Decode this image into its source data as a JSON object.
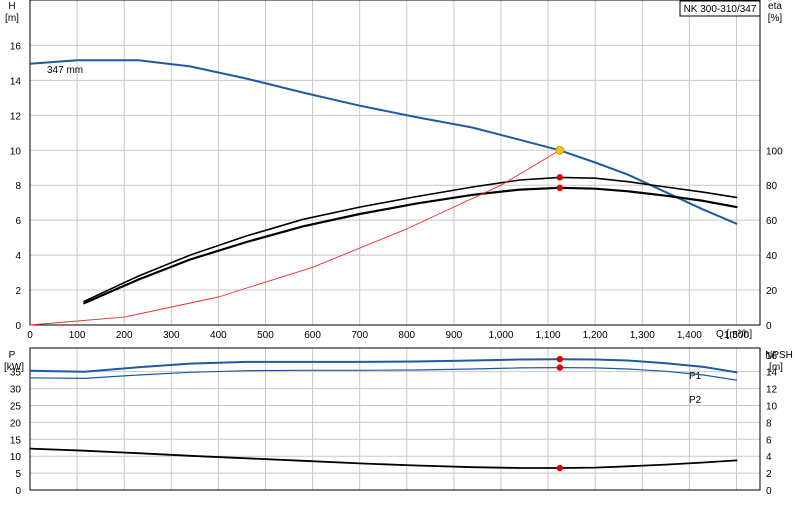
{
  "model": "NK 300-310/347",
  "colors": {
    "head": "#1f5aa0",
    "efficiency": "#000000",
    "npsh": "#000000",
    "system_curve": "#e8302a",
    "power": "#1f5aa0",
    "duty_point_head": "#f5c400",
    "duty_point": "#e00000",
    "grid": "#c8c8c8"
  },
  "chart_data": [
    {
      "type": "line",
      "title": "",
      "xlabel": "Q [m³/h]",
      "xlim": [
        0,
        1550
      ],
      "x_ticks": [
        "0",
        "100",
        "200",
        "300",
        "400",
        "500",
        "600",
        "700",
        "800",
        "900",
        "1,000",
        "1,100",
        "1,200",
        "1,300",
        "1,400",
        "1,500"
      ],
      "left_axis": {
        "label_top": "H",
        "label_unit": "[m]",
        "ylim": [
          0,
          18.6
        ],
        "ticks": [
          "0",
          "2",
          "4",
          "6",
          "8",
          "10",
          "12",
          "14",
          "16"
        ]
      },
      "right_axis": {
        "label_top": "eta",
        "label_unit": "[%]",
        "ylim": [
          0,
          186
        ],
        "ticks": [
          "0",
          "20",
          "40",
          "60",
          "80",
          "100"
        ]
      },
      "annotations": [
        {
          "text": "347 mm"
        }
      ],
      "grid": true,
      "series": [
        {
          "id": "head",
          "axis": "left",
          "x": [
            0,
            100,
            230,
            340,
            460,
            580,
            700,
            820,
            940,
            1040,
            1125,
            1200,
            1270,
            1350,
            1430,
            1500
          ],
          "y": [
            14.95,
            15.15,
            15.15,
            14.8,
            14.1,
            13.3,
            12.55,
            11.9,
            11.3,
            10.6,
            10.0,
            9.3,
            8.6,
            7.6,
            6.6,
            5.8
          ]
        },
        {
          "id": "efficiency_1",
          "axis": "right",
          "x": [
            115,
            230,
            340,
            460,
            580,
            700,
            820,
            940,
            1040,
            1125,
            1200,
            1270,
            1350,
            1430,
            1500
          ],
          "y": [
            13.5,
            28,
            40,
            51,
            60.5,
            67.5,
            73.5,
            79,
            83,
            84.5,
            84,
            82,
            79,
            76,
            73
          ]
        },
        {
          "id": "efficiency_2",
          "axis": "right",
          "x": [
            115,
            230,
            340,
            460,
            580,
            700,
            820,
            940,
            1040,
            1125,
            1200,
            1270,
            1350,
            1430,
            1500
          ],
          "y": [
            12.5,
            26,
            37.5,
            47.5,
            56.5,
            63.5,
            69.5,
            74.5,
            77.5,
            78.5,
            78,
            76.5,
            74,
            71,
            67.5
          ]
        },
        {
          "id": "system_curve",
          "axis": "left",
          "x": [
            0,
            200,
            400,
            600,
            800,
            1000,
            1125
          ],
          "y": [
            0,
            0.45,
            1.6,
            3.3,
            5.5,
            8.0,
            10.0
          ]
        }
      ],
      "points": [
        {
          "id": "duty_head",
          "axis": "left",
          "x": 1125,
          "y": 10.0
        },
        {
          "id": "duty_eta_1",
          "axis": "right",
          "x": 1125,
          "y": 84.5
        },
        {
          "id": "duty_eta_2",
          "axis": "right",
          "x": 1125,
          "y": 78.5
        }
      ]
    },
    {
      "type": "line",
      "title": "",
      "xlim": [
        0,
        1550
      ],
      "left_axis": {
        "label_top": "P",
        "label_unit": "[kW]",
        "ylim": [
          0,
          42
        ],
        "ticks": [
          "0",
          "5",
          "10",
          "15",
          "20",
          "25",
          "30",
          "35"
        ]
      },
      "right_axis": {
        "label_top": "NPSH",
        "label_unit": "[m]",
        "ylim": [
          0,
          16.8
        ],
        "ticks": [
          "0",
          "2",
          "4",
          "6",
          "8",
          "10",
          "12",
          "14",
          "16"
        ]
      },
      "grid": true,
      "series": [
        {
          "id": "P1",
          "name": "P1",
          "axis": "left",
          "x": [
            0,
            115,
            230,
            340,
            460,
            580,
            700,
            820,
            940,
            1040,
            1125,
            1200,
            1270,
            1350,
            1430,
            1500
          ],
          "y": [
            35.3,
            35.0,
            36.3,
            37.4,
            37.9,
            37.9,
            37.9,
            38.0,
            38.3,
            38.6,
            38.7,
            38.6,
            38.3,
            37.5,
            36.4,
            34.8
          ]
        },
        {
          "id": "P2",
          "name": "P2",
          "axis": "left",
          "x": [
            0,
            115,
            230,
            340,
            460,
            580,
            700,
            820,
            940,
            1040,
            1125,
            1200,
            1270,
            1350,
            1430,
            1500
          ],
          "y": [
            33.2,
            33.0,
            34.0,
            34.8,
            35.3,
            35.4,
            35.4,
            35.5,
            35.8,
            36.1,
            36.2,
            36.1,
            35.8,
            35.1,
            34.0,
            32.5
          ]
        },
        {
          "id": "npsh",
          "axis": "right",
          "x": [
            0,
            115,
            230,
            340,
            460,
            580,
            700,
            820,
            940,
            1040,
            1125,
            1200,
            1270,
            1350,
            1430,
            1500
          ],
          "y": [
            4.9,
            4.65,
            4.35,
            4.05,
            3.75,
            3.45,
            3.15,
            2.9,
            2.7,
            2.6,
            2.6,
            2.65,
            2.8,
            3.0,
            3.25,
            3.5
          ]
        }
      ],
      "points": [
        {
          "id": "duty_P1",
          "axis": "left",
          "x": 1125,
          "y": 38.7
        },
        {
          "id": "duty_P2",
          "axis": "left",
          "x": 1125,
          "y": 36.2
        },
        {
          "id": "duty_npsh",
          "axis": "right",
          "x": 1125,
          "y": 2.6
        }
      ]
    }
  ]
}
